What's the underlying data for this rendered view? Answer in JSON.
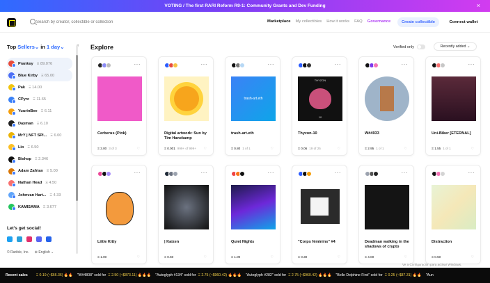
{
  "banner": {
    "text": "VOTING / The first RARI Reform R9-1: Community Grants and Dev Funding",
    "close": "×"
  },
  "header": {
    "search_placeholder": "Search by creator, collectible or collection",
    "nav": [
      {
        "label": "Marketplace",
        "kind": "active"
      },
      {
        "label": "My collectibles",
        "kind": ""
      },
      {
        "label": "How it works",
        "kind": ""
      },
      {
        "label": "FAQ",
        "kind": ""
      },
      {
        "label": "Governance",
        "kind": "gov"
      }
    ],
    "create_label": "Create collectible",
    "wallet_label": "Connect wallet"
  },
  "sidebar": {
    "title_prefix": "Top",
    "title_link": "Sellers",
    "title_mid": "in",
    "period": "1 day",
    "collapse": "«",
    "sellers": [
      {
        "rank": "1",
        "name": "Pranksy",
        "amount": "Ξ 89.076",
        "color": "#e74b3c",
        "hl": true
      },
      {
        "rank": "2",
        "name": "Blue Kirby",
        "amount": "Ξ 65.00",
        "color": "#4c6ef5",
        "hl": true
      },
      {
        "rank": "3",
        "name": "Pak",
        "amount": "Ξ 14.00",
        "color": "#f1c40f",
        "hl": false
      },
      {
        "rank": "4",
        "name": "CPyrc",
        "amount": "Ξ 11.65",
        "color": "#3b82f6",
        "hl": false
      },
      {
        "rank": "5",
        "name": "YuurinBee",
        "amount": "Ξ 6.11",
        "color": "#f59e0b",
        "hl": false
      },
      {
        "rank": "6",
        "name": "Dayman",
        "amount": "Ξ 6.10",
        "color": "#222222",
        "hl": false
      },
      {
        "rank": "7",
        "name": "MrY | NFT SPI...",
        "amount": "Ξ 6.00",
        "color": "#eab308",
        "hl": false
      },
      {
        "rank": "8",
        "name": "Lio",
        "amount": "Ξ 6.50",
        "color": "#fbbf24",
        "hl": false
      },
      {
        "rank": "9",
        "name": "Bishop",
        "amount": "Ξ 2.346",
        "color": "#111111",
        "hl": false
      },
      {
        "rank": "10",
        "name": "Adam Zafrian",
        "amount": "Ξ 5.00",
        "color": "#d97706",
        "hl": false
      },
      {
        "rank": "11",
        "name": "Nathan Head",
        "amount": "Ξ 4.50",
        "color": "#f87171",
        "hl": false
      },
      {
        "rank": "12",
        "name": "Johnvan Hart...",
        "amount": "Ξ 4.33",
        "color": "#60a5fa",
        "hl": false
      },
      {
        "rank": "13",
        "name": "KAMISAMA",
        "amount": "Ξ 3.677",
        "color": "#22c55e",
        "hl": false
      }
    ],
    "social_title": "Let's get social!",
    "socials": [
      {
        "name": "twitter",
        "color": "#1da1f2"
      },
      {
        "name": "telegram",
        "color": "#2aa1da"
      },
      {
        "name": "instagram",
        "color": "#e1306c"
      },
      {
        "name": "discord",
        "color": "#5865f2"
      },
      {
        "name": "email",
        "color": "#2563eb"
      }
    ],
    "company": "© Rarible, Inc.",
    "language": "⊕ English ⌄"
  },
  "main": {
    "title": "Explore",
    "verified_label": "Verified only",
    "sort_label": "Recently added ⌄"
  },
  "cards": [
    {
      "title": "Cerberus (Pink)",
      "price": "Ξ 3.00",
      "of": "3 of 3",
      "art": "cerberus",
      "owners": [
        "#222",
        "#8b8bf5",
        "#bbbbbb"
      ]
    },
    {
      "title": "Digital artwork: Sun by Tim Hanekamp",
      "price": "Ξ 0.001",
      "of": "999+ of 999+",
      "art": "sun",
      "owners": [
        "#2b5cff",
        "#e74b3c",
        "#f6c342"
      ]
    },
    {
      "title": "trash-art.eth",
      "price": "Ξ 0.80",
      "of": "1 of 1",
      "art": "trash",
      "art_text": "trash-art.eth",
      "owners": [
        "#111",
        "#777",
        "#b7d8f5"
      ]
    },
    {
      "title": "Thyzon-10",
      "price": "Ξ 0.06",
      "of": "19 of 25",
      "art": "thyzon",
      "art_text": "THYZON",
      "art_sub": "10",
      "owners": [
        "#2b5cff",
        "#111",
        "#333"
      ]
    },
    {
      "title": "W#4933",
      "price": "Ξ 2.95",
      "of": "1 of 1",
      "art": "punk",
      "owners": [
        "#111",
        "#7c3aed",
        "#f472b6"
      ]
    },
    {
      "title": "Uni-Biker [ETERNAL]",
      "price": "Ξ 1.55",
      "of": "1 of 1",
      "art": "biker",
      "owners": [
        "#111",
        "#f87171",
        "#c7c7c7"
      ]
    },
    {
      "title": "Little Kitty",
      "price": "Ξ 1.00",
      "of": "",
      "art": "kitty",
      "owners": [
        "#ec4899",
        "#111",
        "#a78bfa"
      ]
    },
    {
      "title": "| Kaizen",
      "price": "Ξ 0.50",
      "of": "",
      "art": "kaizen",
      "owners": [
        "#1f2937",
        "#6b7280",
        "#9ca3af"
      ]
    },
    {
      "title": "Quiet Nights",
      "price": "Ξ 1.00",
      "of": "",
      "art": "nights",
      "owners": [
        "#ef4444",
        "#f97316",
        "#111"
      ]
    },
    {
      "title": "\"Corps féminins\" #4",
      "price": "Ξ 0.30",
      "of": "",
      "art": "corps",
      "owners": [
        "#2b5cff",
        "#111",
        "#f59e0b"
      ]
    },
    {
      "title": "Deadman walking in the shadows of crypto",
      "price": "Ξ 4.00",
      "of": "",
      "art": "deadman",
      "owners": [
        "#9ca3af",
        "#555",
        "#222"
      ]
    },
    {
      "title": "Distraction",
      "price": "Ξ 0.50",
      "of": "",
      "art": "map",
      "owners": [
        "#111",
        "#f472b6",
        "#d4d4d4"
      ]
    }
  ],
  "ticker": {
    "label": "Recent sales",
    "items": [
      {
        "text": "Ξ 0.19 (~$66.36) 🔥🔥",
        "prefix": ""
      },
      {
        "text": "\"W#4808\" sold for",
        "price": "Ξ 2.50 (~$873.11) 🔥🔥🔥"
      },
      {
        "text": "\"Autoglyph #134\" sold for",
        "price": "Ξ 2.75 (~$960.42) 🔥🔥🔥"
      },
      {
        "text": "\"Autoglyph #282\" sold for",
        "price": "Ξ 2.75 (~$960.42) 🔥🔥🔥"
      },
      {
        "text": "\"Belle Delphine First\" sold for",
        "price": "Ξ 0.25 (~$87.31) 🔥🔥"
      },
      {
        "text": "\"Aun",
        "price": ""
      }
    ],
    "windows_note": "Ve a Configuración para activar Windows."
  }
}
